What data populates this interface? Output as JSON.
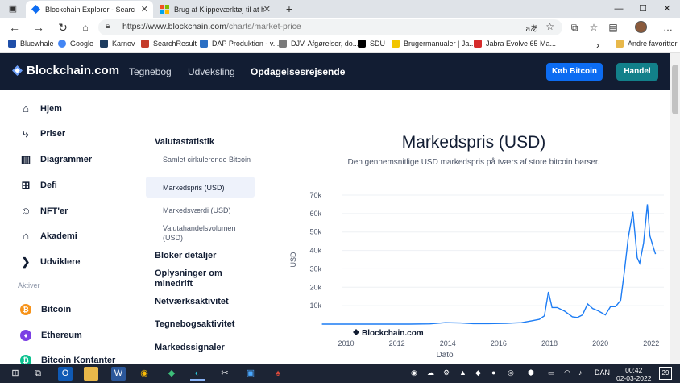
{
  "browser": {
    "tabs": [
      {
        "title": "Blockchain Explorer - Search the"
      },
      {
        "title": "Brug af Klippeværktøj til at hente"
      }
    ],
    "new_tab": "+",
    "url_host": "https://www.blockchain.com",
    "url_path": "/charts/market-price",
    "window_controls": {
      "minimize": "—",
      "maximize": "☐",
      "close": "✕"
    }
  },
  "bookmarks": [
    {
      "label": "Bluewhale",
      "color": "#1f4ea8"
    },
    {
      "label": "Google",
      "color": "#4285f4"
    },
    {
      "label": "Karnov",
      "color": "#1d3b5e"
    },
    {
      "label": "SearchResult",
      "color": "#c43b2a"
    },
    {
      "label": "DAP Produktion - v...",
      "color": "#2a6fc4"
    },
    {
      "label": "DJV, Afgørelser, do...",
      "color": "#7a7a7a"
    },
    {
      "label": "SDU",
      "color": "#000000"
    },
    {
      "label": "Brugermanualer | Ja...",
      "color": "#f2c500"
    },
    {
      "label": "Jabra Evolve 65 Ma...",
      "color": "#d62b2b"
    }
  ],
  "bookmarks_more": "›",
  "bookmarks_other": "Andre favoritter",
  "site": {
    "logo": "Blockchain.com",
    "nav": [
      "Tegnebog",
      "Udveksling",
      "Opdagelsesrejsende"
    ],
    "buy_button": "Køb Bitcoin",
    "trade_button": "Handel"
  },
  "sidebar": {
    "items": [
      {
        "label": "Hjem",
        "icon": "home-icon"
      },
      {
        "label": "Priser",
        "icon": "prices-icon"
      },
      {
        "label": "Diagrammer",
        "icon": "charts-icon"
      },
      {
        "label": "Defi",
        "icon": "defi-icon"
      },
      {
        "label": "NFT'er",
        "icon": "nft-icon"
      },
      {
        "label": "Akademi",
        "icon": "academy-icon"
      },
      {
        "label": "Udviklere",
        "icon": "developers-icon"
      }
    ],
    "section_label": "Aktiver",
    "assets": [
      {
        "label": "Bitcoin",
        "color": "#f7931a"
      },
      {
        "label": "Ethereum",
        "color": "#7b3fe4"
      },
      {
        "label": "Bitcoin Kontanter",
        "color": "#0ac18e"
      }
    ]
  },
  "submenu": {
    "heading": "Valutastatistik",
    "items": [
      "Samlet cirkulerende Bitcoin",
      "Markedspris (USD)",
      "Markedsværdi (USD)",
      "Valutahandelsvolumen (USD)"
    ],
    "active_index": 1,
    "groups": [
      "Bloker detaljer",
      "Oplysninger om minedrift",
      "Netværksaktivitet",
      "Tegnebogsaktivitet",
      "Markedssignaler"
    ]
  },
  "chart_data": {
    "type": "line",
    "title": "Markedspris (USD)",
    "subtitle": "Den gennemsnitlige USD markedspris på tværs af store bitcoin børser.",
    "ylabel": "USD",
    "xlabel": "Dato",
    "watermark": "Blockchain.com",
    "ylim": [
      0,
      70000
    ],
    "xlim": [
      2009.0,
      2022.5
    ],
    "y_ticks": [
      "10k",
      "20k",
      "30k",
      "40k",
      "50k",
      "60k",
      "70k"
    ],
    "x_ticks": [
      "2010",
      "2012",
      "2014",
      "2016",
      "2018",
      "2020",
      "2022"
    ],
    "color": "#1c7cf4",
    "series": [
      {
        "x": [
          2009.05,
          2010.5,
          2011.4,
          2012.5,
          2013.3,
          2013.9,
          2014.5,
          2015.0,
          2015.6,
          2016.3,
          2016.9,
          2017.3,
          2017.6,
          2017.8,
          2017.96,
          2018.1,
          2018.3,
          2018.6,
          2018.9,
          2019.1,
          2019.3,
          2019.5,
          2019.7,
          2019.9,
          2020.2,
          2020.4,
          2020.6,
          2020.8,
          2020.95,
          2021.1,
          2021.28,
          2021.45,
          2021.55,
          2021.7,
          2021.85,
          2021.95,
          2022.1,
          2022.17
        ],
        "y": [
          0,
          0,
          20,
          10,
          150,
          800,
          600,
          250,
          250,
          450,
          800,
          1800,
          2600,
          4500,
          17500,
          9000,
          9000,
          7000,
          4000,
          3600,
          5000,
          11000,
          8500,
          7300,
          5000,
          9500,
          9500,
          13000,
          29000,
          47000,
          61000,
          36000,
          33000,
          44000,
          65000,
          48000,
          41000,
          38000
        ]
      }
    ]
  },
  "taskbar": {
    "time": "00:42",
    "date": "02-03-2022",
    "language": "DAN",
    "notification_count": "29"
  }
}
